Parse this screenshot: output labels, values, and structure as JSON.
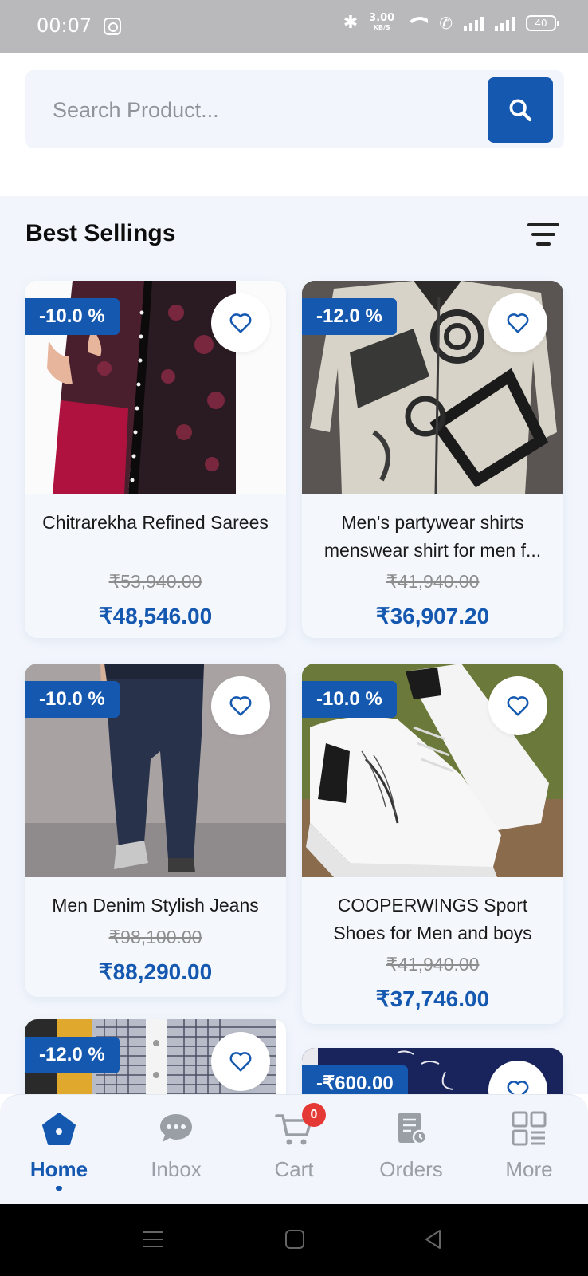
{
  "status_bar": {
    "time": "00:07",
    "speed_value": "3.00",
    "speed_unit": "KB/S",
    "battery": "40"
  },
  "search": {
    "placeholder": "Search Product..."
  },
  "section": {
    "title": "Best Sellings"
  },
  "products": [
    {
      "badge": "-10.0 %",
      "name": "Chitrarekha Refined Sarees",
      "old_price": "₹53,940.00",
      "price": "₹48,546.00"
    },
    {
      "badge": "-12.0 %",
      "name": "Men's partywear shirts menswear shirt for men f...",
      "old_price": "₹41,940.00",
      "price": "₹36,907.20"
    },
    {
      "badge": "-10.0 %",
      "name": "Men Denim Stylish Jeans",
      "old_price": "₹98,100.00",
      "price": "₹88,290.00"
    },
    {
      "badge": "-10.0 %",
      "name": "COOPERWINGS Sport Shoes for Men and boys",
      "old_price": "₹41,940.00",
      "price": "₹37,746.00"
    },
    {
      "badge": "-12.0 %"
    },
    {
      "badge": "-₹600.00"
    }
  ],
  "bottom_nav": {
    "home": "Home",
    "inbox": "Inbox",
    "cart": "Cart",
    "cart_count": "0",
    "orders": "Orders",
    "more": "More"
  },
  "colors": {
    "accent": "#1558b0",
    "background": "#f2f6fc",
    "badge_red": "#e53935"
  }
}
